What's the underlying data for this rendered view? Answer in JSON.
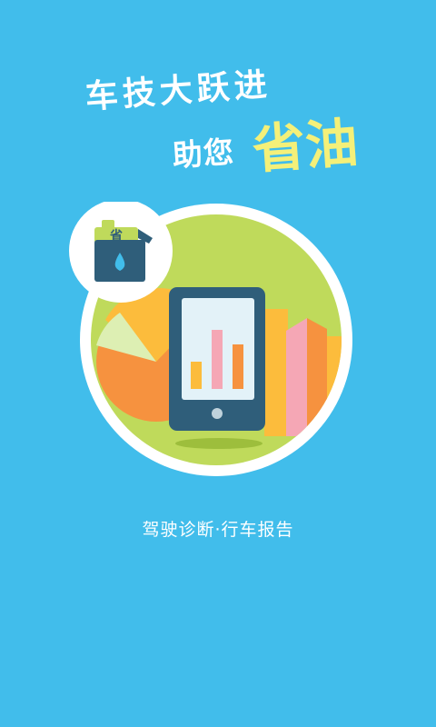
{
  "headline": {
    "line1": "车技大跃进",
    "line2": "助您",
    "highlight": "省油"
  },
  "badge": {
    "can_label": "省"
  },
  "caption": "驾驶诊断·行车报告",
  "colors": {
    "background": "#41BDEB",
    "highlight_text": "#F4F079",
    "circle_fill": "#BFDA5B",
    "phone_body": "#2F5E7A",
    "orange": "#F6923F",
    "yellow": "#FCBC3C",
    "pink": "#F5A7B5"
  }
}
